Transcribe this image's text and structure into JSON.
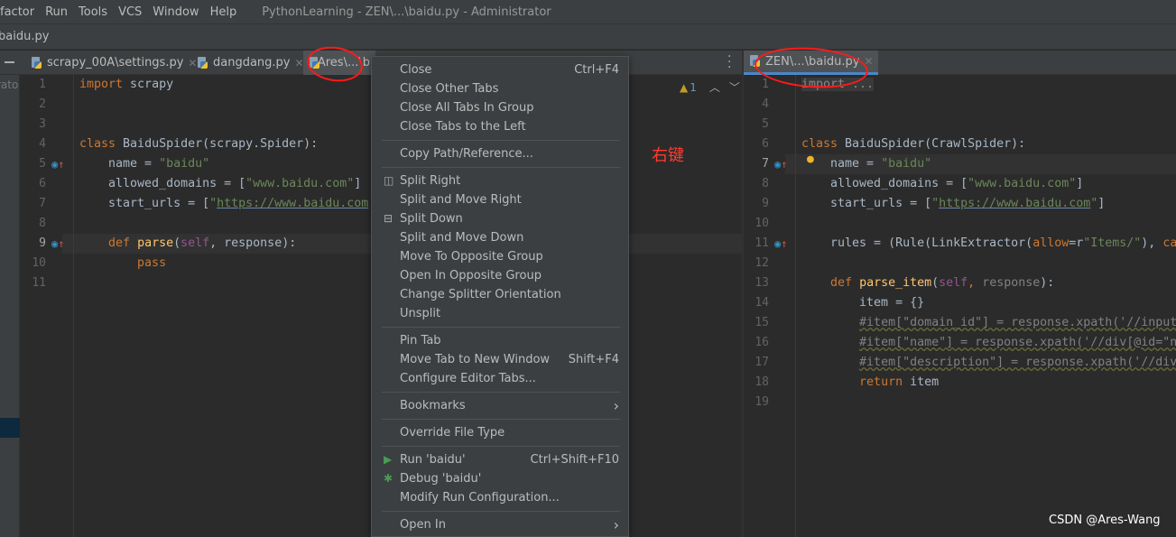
{
  "menubar": {
    "items": [
      "factor",
      "Run",
      "Tools",
      "VCS",
      "Window",
      "Help"
    ],
    "title": "PythonLearning - ZEN\\...\\baidu.py - Administrator"
  },
  "navbar": {
    "file": "baidu.py"
  },
  "left_tabs": [
    {
      "label": "scrapy_00A\\settings.py"
    },
    {
      "label": "dangdang.py"
    },
    {
      "label": "Ares\\...\\b"
    }
  ],
  "right_tabs": [
    {
      "label": "ZEN\\...\\baidu.py"
    }
  ],
  "side_label": "rato",
  "warnings": {
    "count": "1"
  },
  "left_editor": {
    "lines": [
      {
        "n": "1",
        "t": [
          [
            "import ",
            "k"
          ],
          [
            "scrapy",
            "n"
          ]
        ]
      },
      {
        "n": "2",
        "t": []
      },
      {
        "n": "3",
        "t": []
      },
      {
        "n": "4",
        "t": [
          [
            "class ",
            "k"
          ],
          [
            "BaiduSpider(scrapy.Spider):",
            "n"
          ]
        ]
      },
      {
        "n": "5",
        "t": [
          [
            "    name = ",
            "n"
          ],
          [
            "\"baidu\"",
            "s"
          ]
        ]
      },
      {
        "n": "6",
        "t": [
          [
            "    allowed_domains = [",
            "n"
          ],
          [
            "\"www.baidu.com\"",
            "s"
          ],
          [
            "]",
            "n"
          ]
        ]
      },
      {
        "n": "7",
        "t": [
          [
            "    start_urls = [",
            "n"
          ],
          [
            "\"",
            "s"
          ],
          [
            "https://www.baidu.com",
            "u"
          ]
        ]
      },
      {
        "n": "8",
        "t": []
      },
      {
        "n": "9",
        "t": [
          [
            "    ",
            "n"
          ],
          [
            "def ",
            "k"
          ],
          [
            "parse",
            "f"
          ],
          [
            "(",
            "n"
          ],
          [
            "self",
            "p"
          ],
          [
            ", response",
            "n"
          ],
          [
            "):",
            "n"
          ]
        ]
      },
      {
        "n": "10",
        "t": [
          [
            "        ",
            "n"
          ],
          [
            "pass",
            "k"
          ]
        ]
      },
      {
        "n": "11",
        "t": []
      }
    ]
  },
  "right_editor": {
    "lines": [
      {
        "n": "1",
        "t": [
          [
            "import ...",
            "fold"
          ]
        ]
      },
      {
        "n": "4",
        "t": []
      },
      {
        "n": "5",
        "t": []
      },
      {
        "n": "6",
        "t": [
          [
            "class ",
            "k"
          ],
          [
            "BaiduSpider(CrawlSpider):",
            "n"
          ]
        ]
      },
      {
        "n": "7",
        "t": [
          [
            "    name = ",
            "n"
          ],
          [
            "\"baidu\"",
            "s"
          ]
        ]
      },
      {
        "n": "8",
        "t": [
          [
            "    allowed_domains = [",
            "n"
          ],
          [
            "\"www.baidu.com\"",
            "s"
          ],
          [
            "]",
            "n"
          ]
        ]
      },
      {
        "n": "9",
        "t": [
          [
            "    start_urls = [",
            "n"
          ],
          [
            "\"",
            "s"
          ],
          [
            "https://www.baidu.com",
            "u"
          ],
          [
            "\"",
            "s"
          ],
          [
            "]",
            "n"
          ]
        ]
      },
      {
        "n": "10",
        "t": []
      },
      {
        "n": "11",
        "t": [
          [
            "    rules = (Rule(LinkExtractor(",
            "n"
          ],
          [
            "allow",
            "k"
          ],
          [
            "=r",
            "n"
          ],
          [
            "\"Items/\"",
            "s"
          ],
          [
            "), ",
            "n"
          ],
          [
            "ca",
            "k"
          ]
        ]
      },
      {
        "n": "12",
        "t": []
      },
      {
        "n": "13",
        "t": [
          [
            "    ",
            "n"
          ],
          [
            "def ",
            "k"
          ],
          [
            "parse_item",
            "f"
          ],
          [
            "(",
            "n"
          ],
          [
            "self",
            "p"
          ],
          [
            ", ",
            "k"
          ],
          [
            "response",
            "g"
          ],
          [
            "):",
            "n"
          ]
        ]
      },
      {
        "n": "14",
        "t": [
          [
            "        item = {}",
            "n"
          ]
        ]
      },
      {
        "n": "15",
        "t": [
          [
            "        ",
            "n"
          ],
          [
            "#item[\"domain_id\"] = response.xpath('//input",
            "c"
          ]
        ]
      },
      {
        "n": "16",
        "t": [
          [
            "        ",
            "n"
          ],
          [
            "#item[\"name\"] = response.xpath('//div[@id=\"n",
            "c"
          ]
        ]
      },
      {
        "n": "17",
        "t": [
          [
            "        ",
            "n"
          ],
          [
            "#item[\"description\"] = response.xpath('//div",
            "c"
          ]
        ]
      },
      {
        "n": "18",
        "t": [
          [
            "        ",
            "n"
          ],
          [
            "return ",
            "k"
          ],
          [
            "item",
            "n"
          ]
        ]
      },
      {
        "n": "19",
        "t": []
      }
    ]
  },
  "context_menu": {
    "items": [
      {
        "label": "Close",
        "shortcut": "Ctrl+F4"
      },
      {
        "label": "Close Other Tabs"
      },
      {
        "label": "Close All Tabs In Group"
      },
      {
        "label": "Close Tabs to the Left"
      },
      {
        "sep": true
      },
      {
        "label": "Copy Path/Reference..."
      },
      {
        "sep": true
      },
      {
        "label": "Split Right",
        "icon": "split-right"
      },
      {
        "label": "Split and Move Right"
      },
      {
        "label": "Split Down",
        "icon": "split-down"
      },
      {
        "label": "Split and Move Down"
      },
      {
        "label": "Move To Opposite Group"
      },
      {
        "label": "Open In Opposite Group"
      },
      {
        "label": "Change Splitter Orientation"
      },
      {
        "label": "Unsplit"
      },
      {
        "sep": true
      },
      {
        "label": "Pin Tab"
      },
      {
        "label": "Move Tab to New Window",
        "shortcut": "Shift+F4"
      },
      {
        "label": "Configure Editor Tabs..."
      },
      {
        "sep": true
      },
      {
        "label": "Bookmarks",
        "submenu": true
      },
      {
        "sep": true
      },
      {
        "label": "Override File Type"
      },
      {
        "sep": true
      },
      {
        "label": "Run 'baidu'",
        "shortcut": "Ctrl+Shift+F10",
        "icon": "run"
      },
      {
        "label": "Debug 'baidu'",
        "icon": "debug"
      },
      {
        "label": "Modify Run Configuration..."
      },
      {
        "sep": true
      },
      {
        "label": "Open In",
        "submenu": true
      }
    ]
  },
  "annotation": "右键",
  "watermark": "CSDN @Ares-Wang",
  "colors": {
    "accent": "#4a88c7",
    "annotation": "#ff1a1a",
    "keyword": "#cc7832",
    "string": "#6a8759"
  }
}
